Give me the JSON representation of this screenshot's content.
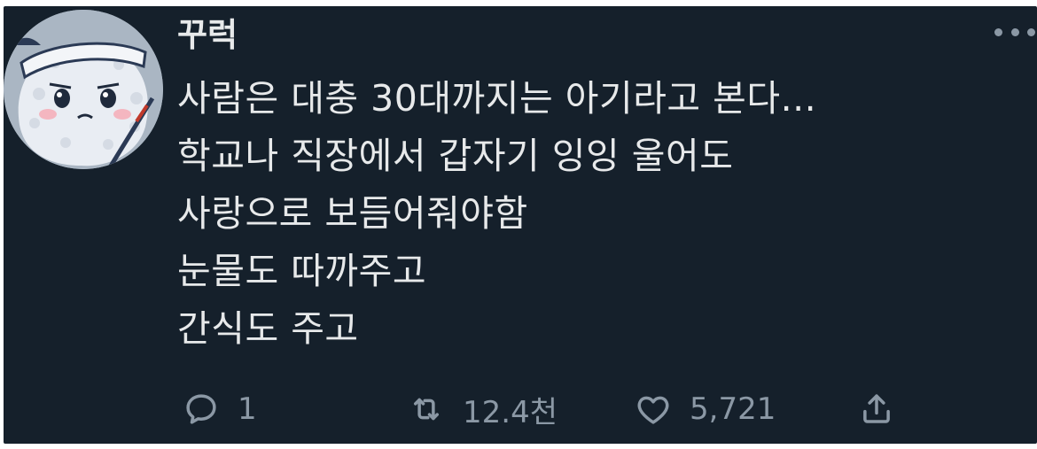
{
  "tweet": {
    "author_name": "꾸럭",
    "lines": [
      "사람은 대충 30대까지는 아기라고 본다...",
      "학교나 직장에서 갑자기 잉잉 울어도",
      "사랑으로 보듬어줘야함",
      "눈물도 따까주고",
      "간식도 주고"
    ],
    "actions": {
      "reply_count": "1",
      "retweet_count": "12.4천",
      "like_count": "5,721"
    }
  },
  "icons": {
    "avatar": "rice-cake-character-avatar",
    "more": "more-options-icon",
    "reply": "reply-icon",
    "retweet": "retweet-icon",
    "like": "heart-icon",
    "share": "share-icon"
  },
  "colors": {
    "background": "#15202b",
    "text": "#e7e9ea",
    "muted": "#8b98a5"
  }
}
